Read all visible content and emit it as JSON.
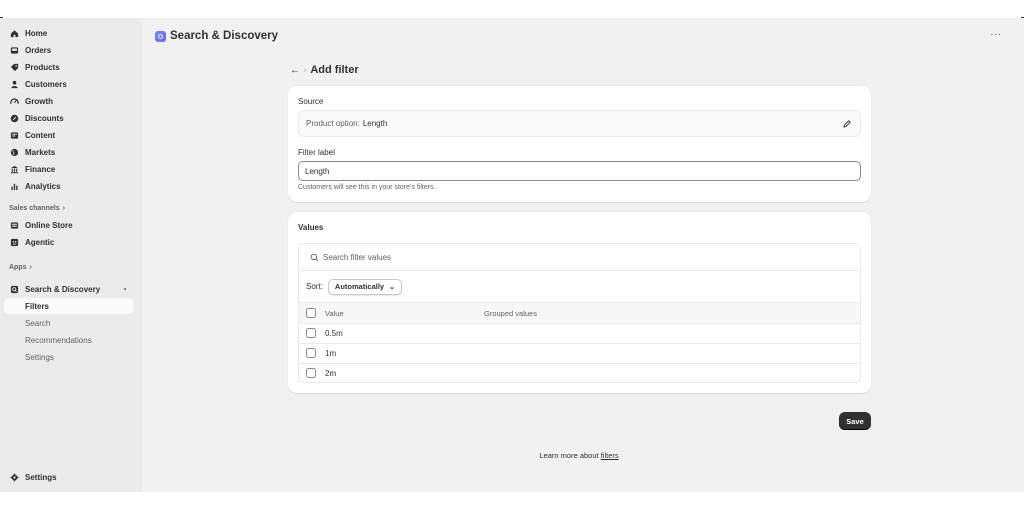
{
  "sidebar": {
    "nav": [
      {
        "label": "Home",
        "icon": "home-icon"
      },
      {
        "label": "Orders",
        "icon": "inbox-icon"
      },
      {
        "label": "Products",
        "icon": "tag-icon"
      },
      {
        "label": "Customers",
        "icon": "person-icon"
      },
      {
        "label": "Growth",
        "icon": "gauge-icon"
      },
      {
        "label": "Discounts",
        "icon": "discount-icon"
      },
      {
        "label": "Content",
        "icon": "content-icon"
      },
      {
        "label": "Markets",
        "icon": "globe-icon"
      },
      {
        "label": "Finance",
        "icon": "bank-icon"
      },
      {
        "label": "Analytics",
        "icon": "bar-chart-icon"
      }
    ],
    "sales_channels_label": "Sales channels",
    "channels": [
      {
        "label": "Online Store",
        "icon": "store-icon"
      },
      {
        "label": "Agentic",
        "icon": "agentic-icon"
      }
    ],
    "apps_label": "Apps",
    "app": {
      "label": "Search & Discovery",
      "icon": "search-discovery-icon"
    },
    "subitems": [
      "Filters",
      "Search",
      "Recommendations",
      "Settings"
    ],
    "settings_label": "Settings"
  },
  "header": {
    "app_title": "Search & Discovery",
    "more": "···"
  },
  "page": {
    "back": "←",
    "sep": "›",
    "title": "Add filter"
  },
  "source": {
    "label": "Source",
    "key": "Product option:",
    "value": "Length"
  },
  "filter_label": {
    "label": "Filter label",
    "value": "Length",
    "help": "Customers will see this in your store's filters."
  },
  "values": {
    "label": "Values",
    "search_placeholder": "Search filter values",
    "sort_label": "Sort:",
    "sort_value": "Automatically",
    "columns": [
      "Value",
      "Grouped values"
    ],
    "rows": [
      "0.5m",
      "1m",
      "2m"
    ]
  },
  "actions": {
    "save": "Save"
  },
  "footer": {
    "learn_prefix": "Learn more about ",
    "learn_link": "filters"
  },
  "colors": {
    "background": "#f1f1f1",
    "sidebar": "#ebebeb",
    "card": "#ffffff",
    "primary_button": "#303030"
  }
}
